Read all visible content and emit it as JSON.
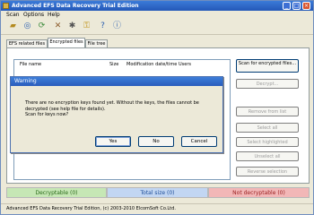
{
  "window": {
    "title": "Advanced EFS Data Recovery Trial Edition"
  },
  "menu": [
    "Scan",
    "Options",
    "Help"
  ],
  "toolbar": [
    "open-folder-icon",
    "find-icon",
    "scan-icon",
    "tools-icon",
    "settings-icon",
    "key-icon",
    "help-icon",
    "info-icon"
  ],
  "tabs": [
    "EFS related files",
    "Encrypted files",
    "File tree"
  ],
  "list": {
    "headers": [
      "File name",
      "Size",
      "Modification date/time",
      "Users"
    ]
  },
  "buttons": {
    "scan": "Scan for encrypted files...",
    "decrypt": "Decrypt...",
    "remove_from_list": "Remove from list",
    "select_all": "Select all",
    "select_highlighted": "Select highlighted",
    "unselect_all": "Unselect all",
    "reverse_selection": "Reverse selection"
  },
  "status": {
    "decryptable": "Decryptable (0)",
    "total": "Total size (0)",
    "not_decryptable": "Not decryptable (0)",
    "colors": {
      "decryptable": "#c6e7b5",
      "total": "#c2d6f2",
      "not_decryptable": "#f2b7b7"
    }
  },
  "footer": "Advanced EFS Data Recovery Trial Edition, (c) 2003-2010 ElcomSoft Co.Ltd.",
  "dialog": {
    "title": "Warning",
    "message_lines": [
      "There are no encryption keys found yet. Without the keys, the files cannot be",
      "decrypted (see help file for details).",
      "Scan for keys now?"
    ],
    "yes": "Yes",
    "no": "No",
    "cancel": "Cancel"
  }
}
